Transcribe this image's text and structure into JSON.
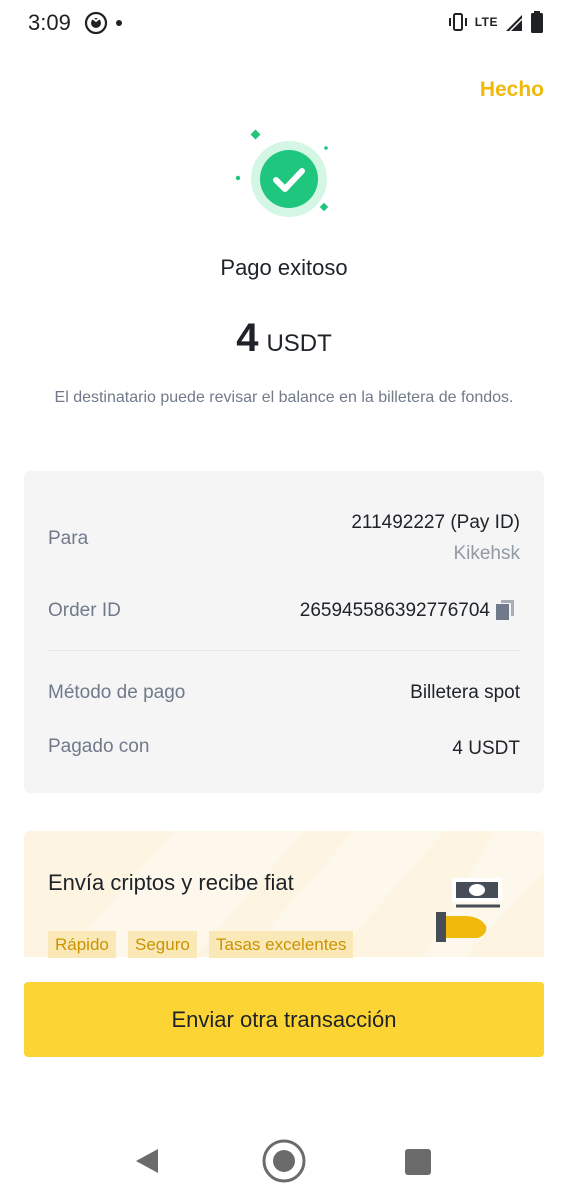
{
  "status_bar": {
    "time": "3:09",
    "network": "LTE"
  },
  "header": {
    "done_label": "Hecho"
  },
  "result": {
    "title": "Pago exitoso",
    "amount": "4",
    "currency": "USDT",
    "note": "El destinatario puede revisar el balance en la billetera de fondos."
  },
  "details": {
    "to_label": "Para",
    "to_value": "211492227 (Pay ID)",
    "to_name": "Kikehsk",
    "order_label": "Order ID",
    "order_value": "265945586392776704",
    "method_label": "Método de pago",
    "method_value": "Billetera spot",
    "paid_label": "Pagado con",
    "paid_value": "4 USDT"
  },
  "promo": {
    "title": "Envía criptos y recibe fiat",
    "tags": [
      "Rápido",
      "Seguro",
      "Tasas excelentes"
    ]
  },
  "action": {
    "primary_label": "Enviar otra transacción"
  },
  "colors": {
    "accent": "#F0B90B",
    "button": "#FCD535",
    "success": "#1FC77E"
  },
  "icons": [
    "radio-icon",
    "vibrate-icon",
    "signal-icon",
    "battery-icon",
    "success-check-icon",
    "copy-icon",
    "cash-hand-icon",
    "back-nav-icon",
    "home-nav-icon",
    "recents-nav-icon"
  ]
}
